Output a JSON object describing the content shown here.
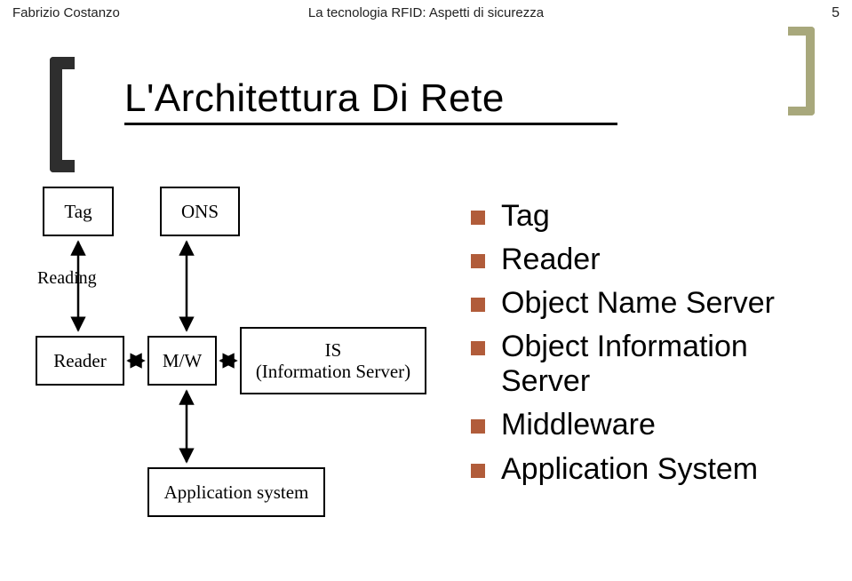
{
  "header": {
    "author": "Fabrizio Costanzo",
    "doc_title": "La tecnologia RFID: Aspetti di sicurezza",
    "page_number": "5"
  },
  "title": "L'Architettura Di Rete",
  "diagram": {
    "tag": "Tag",
    "ons": "ONS",
    "reader": "Reader",
    "mw": "M/W",
    "is_line1": "IS",
    "is_line2": "(Information Server)",
    "app": "Application system",
    "reading_label": "Reading"
  },
  "bullets": [
    "Tag",
    "Reader",
    "Object Name Server",
    "Object Information Server",
    "Middleware",
    "Application System"
  ],
  "colors": {
    "bullet": "#b15c3a",
    "accent_bracket": "#999966"
  }
}
